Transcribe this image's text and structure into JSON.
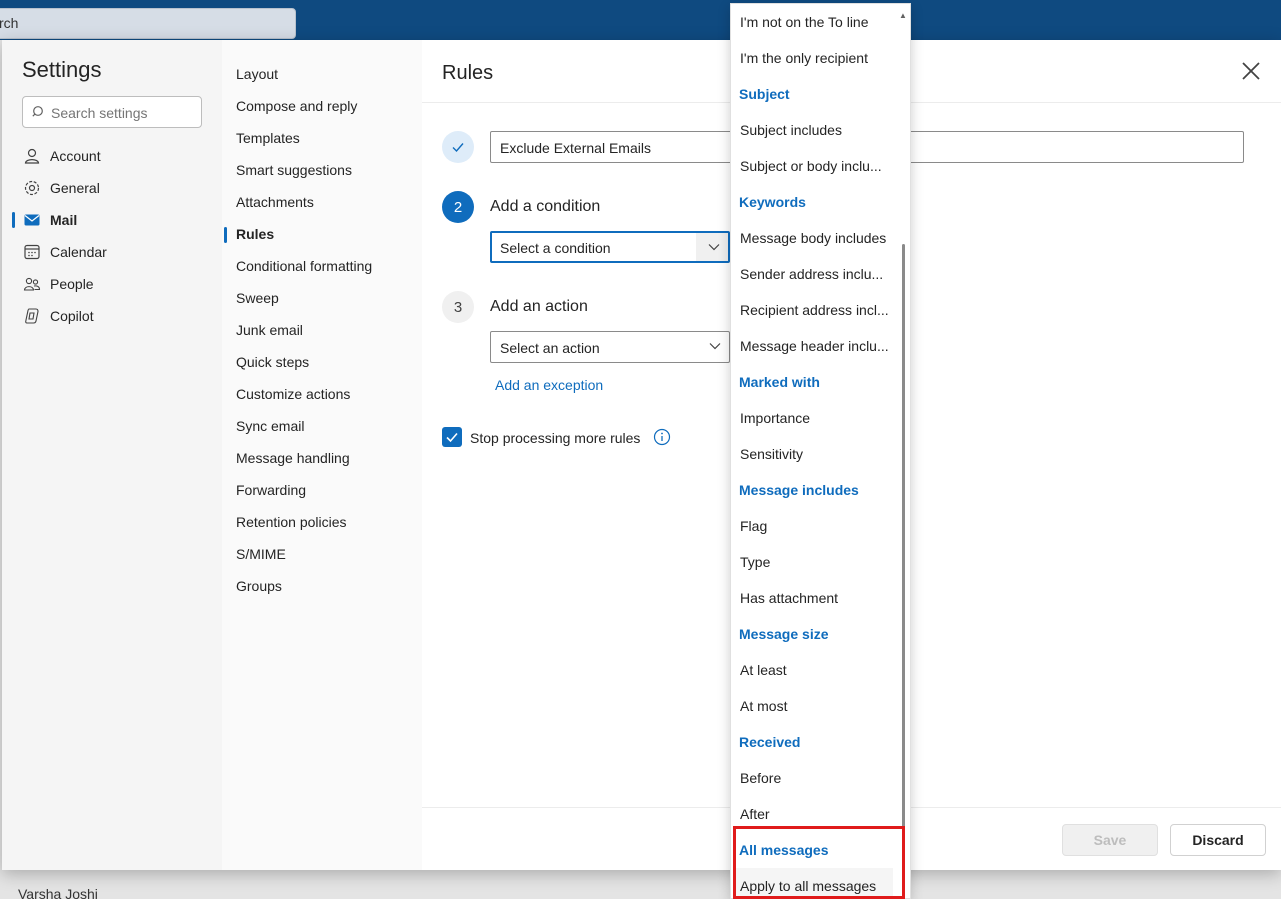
{
  "background": {
    "search_text": "rch",
    "user_name": "Varsha Joshi"
  },
  "settings": {
    "title": "Settings",
    "search_placeholder": "Search settings",
    "nav": [
      {
        "label": "Account",
        "icon": "person-icon"
      },
      {
        "label": "General",
        "icon": "gear-icon"
      },
      {
        "label": "Mail",
        "icon": "mail-icon",
        "active": true
      },
      {
        "label": "Calendar",
        "icon": "calendar-icon"
      },
      {
        "label": "People",
        "icon": "people-icon"
      },
      {
        "label": "Copilot",
        "icon": "copilot-icon"
      }
    ],
    "mail_nav": [
      "Layout",
      "Compose and reply",
      "Templates",
      "Smart suggestions",
      "Attachments",
      "Rules",
      "Conditional formatting",
      "Sweep",
      "Junk email",
      "Quick steps",
      "Customize actions",
      "Sync email",
      "Message handling",
      "Forwarding",
      "Retention policies",
      "S/MIME",
      "Groups"
    ],
    "mail_nav_active": "Rules"
  },
  "rules": {
    "title": "Rules",
    "step1_number": "",
    "rule_name": "Exclude External Emails",
    "step2_number": "2",
    "step2_label": "Add a condition",
    "condition_placeholder": "Select a condition",
    "step3_number": "3",
    "step3_label": "Add an action",
    "action_placeholder": "Select an action",
    "exception_link": "Add an exception",
    "stop_processing_label": "Stop processing more rules",
    "stop_processing_checked": true,
    "save_label": "Save",
    "discard_label": "Discard"
  },
  "dropdown": {
    "items": [
      {
        "type": "item",
        "label": "I'm not on the To line"
      },
      {
        "type": "item",
        "label": "I'm the only recipient"
      },
      {
        "type": "header",
        "label": "Subject"
      },
      {
        "type": "item",
        "label": "Subject includes"
      },
      {
        "type": "item",
        "label": "Subject or body inclu..."
      },
      {
        "type": "header",
        "label": "Keywords"
      },
      {
        "type": "item",
        "label": "Message body includes"
      },
      {
        "type": "item",
        "label": "Sender address inclu..."
      },
      {
        "type": "item",
        "label": "Recipient address incl..."
      },
      {
        "type": "item",
        "label": "Message header inclu..."
      },
      {
        "type": "header",
        "label": "Marked with"
      },
      {
        "type": "item",
        "label": "Importance"
      },
      {
        "type": "item",
        "label": "Sensitivity"
      },
      {
        "type": "header",
        "label": "Message includes"
      },
      {
        "type": "item",
        "label": "Flag"
      },
      {
        "type": "item",
        "label": "Type"
      },
      {
        "type": "item",
        "label": "Has attachment"
      },
      {
        "type": "header",
        "label": "Message size"
      },
      {
        "type": "item",
        "label": "At least"
      },
      {
        "type": "item",
        "label": "At most"
      },
      {
        "type": "header",
        "label": "Received"
      },
      {
        "type": "item",
        "label": "Before"
      },
      {
        "type": "item",
        "label": "After"
      },
      {
        "type": "header",
        "label": "All messages"
      },
      {
        "type": "item",
        "label": "Apply to all messages",
        "hover": true
      }
    ]
  },
  "colors": {
    "accent": "#0f6cbd",
    "highlight": "#e01b1b",
    "topbar": "#0f4a80"
  }
}
